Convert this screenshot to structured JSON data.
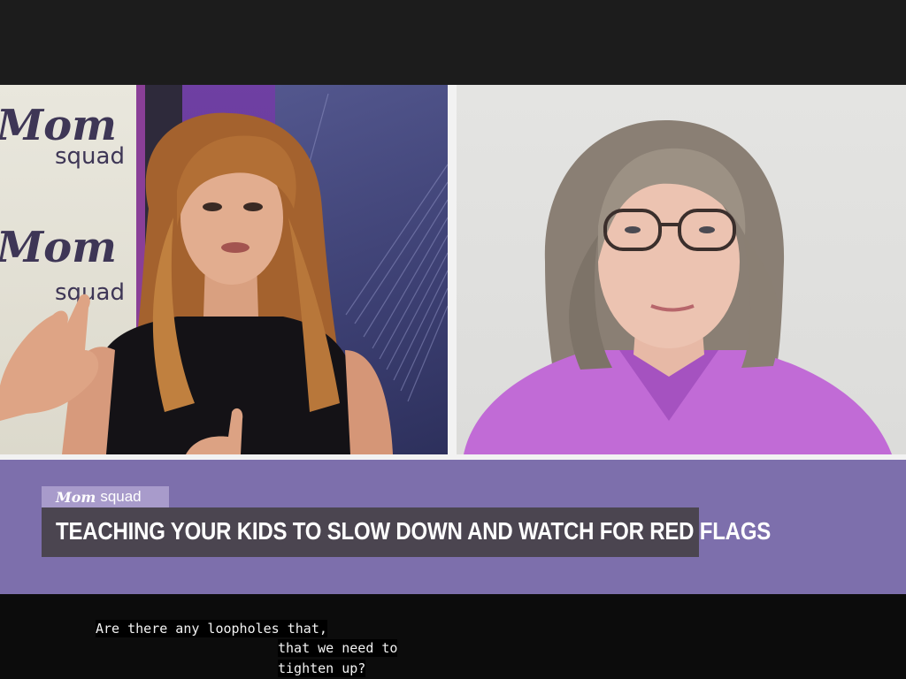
{
  "studio_set": {
    "wall_logos": [
      {
        "brand": "Mom",
        "sub": "squad"
      },
      {
        "brand": "Mom",
        "sub": "squad"
      }
    ]
  },
  "lower_third": {
    "show_brand": "Mom",
    "show_sub": "squad",
    "headline": "TEACHING YOUR KIDS TO SLOW DOWN AND WATCH FOR RED FLAGS"
  },
  "captions": {
    "line1": "Are there any loopholes that,",
    "line2": "that we need to",
    "line3": "tighten up?"
  },
  "colors": {
    "lower_third_bg": "#7d6fac",
    "headline_bg": "#4b4550",
    "guest_top": "#c26ad8"
  }
}
